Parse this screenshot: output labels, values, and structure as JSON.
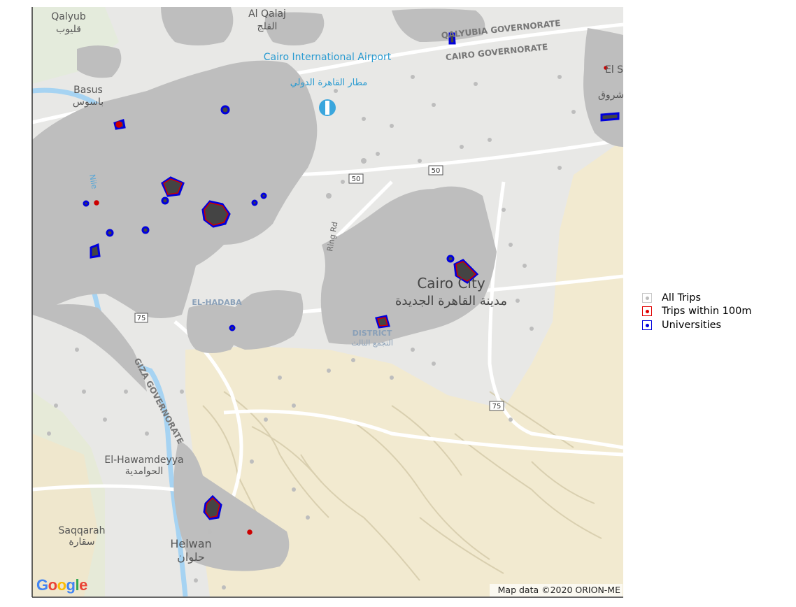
{
  "map": {
    "place_labels": [
      {
        "id": "qalyub",
        "en": "Qalyub",
        "ar": "قليوب"
      },
      {
        "id": "al-qalaj",
        "en": "Al Qalaj",
        "ar": "القلج"
      },
      {
        "id": "cairo-airport",
        "en": "Cairo International Airport",
        "ar": "مطار القاهرة الدولي"
      },
      {
        "id": "qalyubia-gov",
        "en": "QALYUBIA GOVERNORATE"
      },
      {
        "id": "cairo-gov",
        "en": "CAIRO GOVERNORATE"
      },
      {
        "id": "basus",
        "en": "Basus",
        "ar": "باسوس"
      },
      {
        "id": "el-sh",
        "en": "El S",
        "ar": "شروق"
      },
      {
        "id": "new-cairo",
        "en": "Cairo City",
        "ar": "مدينة القاهرة الجديدة"
      },
      {
        "id": "el-hadaba",
        "en": "EL-HADABA"
      },
      {
        "id": "giza-gov",
        "en": "GIZA GOVERNORATE"
      },
      {
        "id": "el-hawamdeyya",
        "en": "El-Hawamdeyya",
        "ar": "الحوامدية"
      },
      {
        "id": "saqqarah",
        "en": "Saqqarah",
        "ar": "سقارة"
      },
      {
        "id": "helwan",
        "en": "Helwan",
        "ar": "حلوان"
      },
      {
        "id": "third-district",
        "en": "DISTRICT",
        "ar": "التجمع الثالث"
      },
      {
        "id": "ring-rd",
        "en": "Ring Rd"
      },
      {
        "id": "nile",
        "en": "Nile"
      }
    ],
    "road_shields": [
      "50",
      "50",
      "75",
      "75"
    ],
    "google_logo": "Google",
    "attribution": "Map data ©2020 ORION-ME"
  },
  "legend": {
    "items": [
      {
        "label": "All Trips",
        "color": "#bdbdbd"
      },
      {
        "label": "Trips within 100m",
        "color": "#e00000"
      },
      {
        "label": "Universities",
        "color": "#0000dd"
      }
    ]
  }
}
